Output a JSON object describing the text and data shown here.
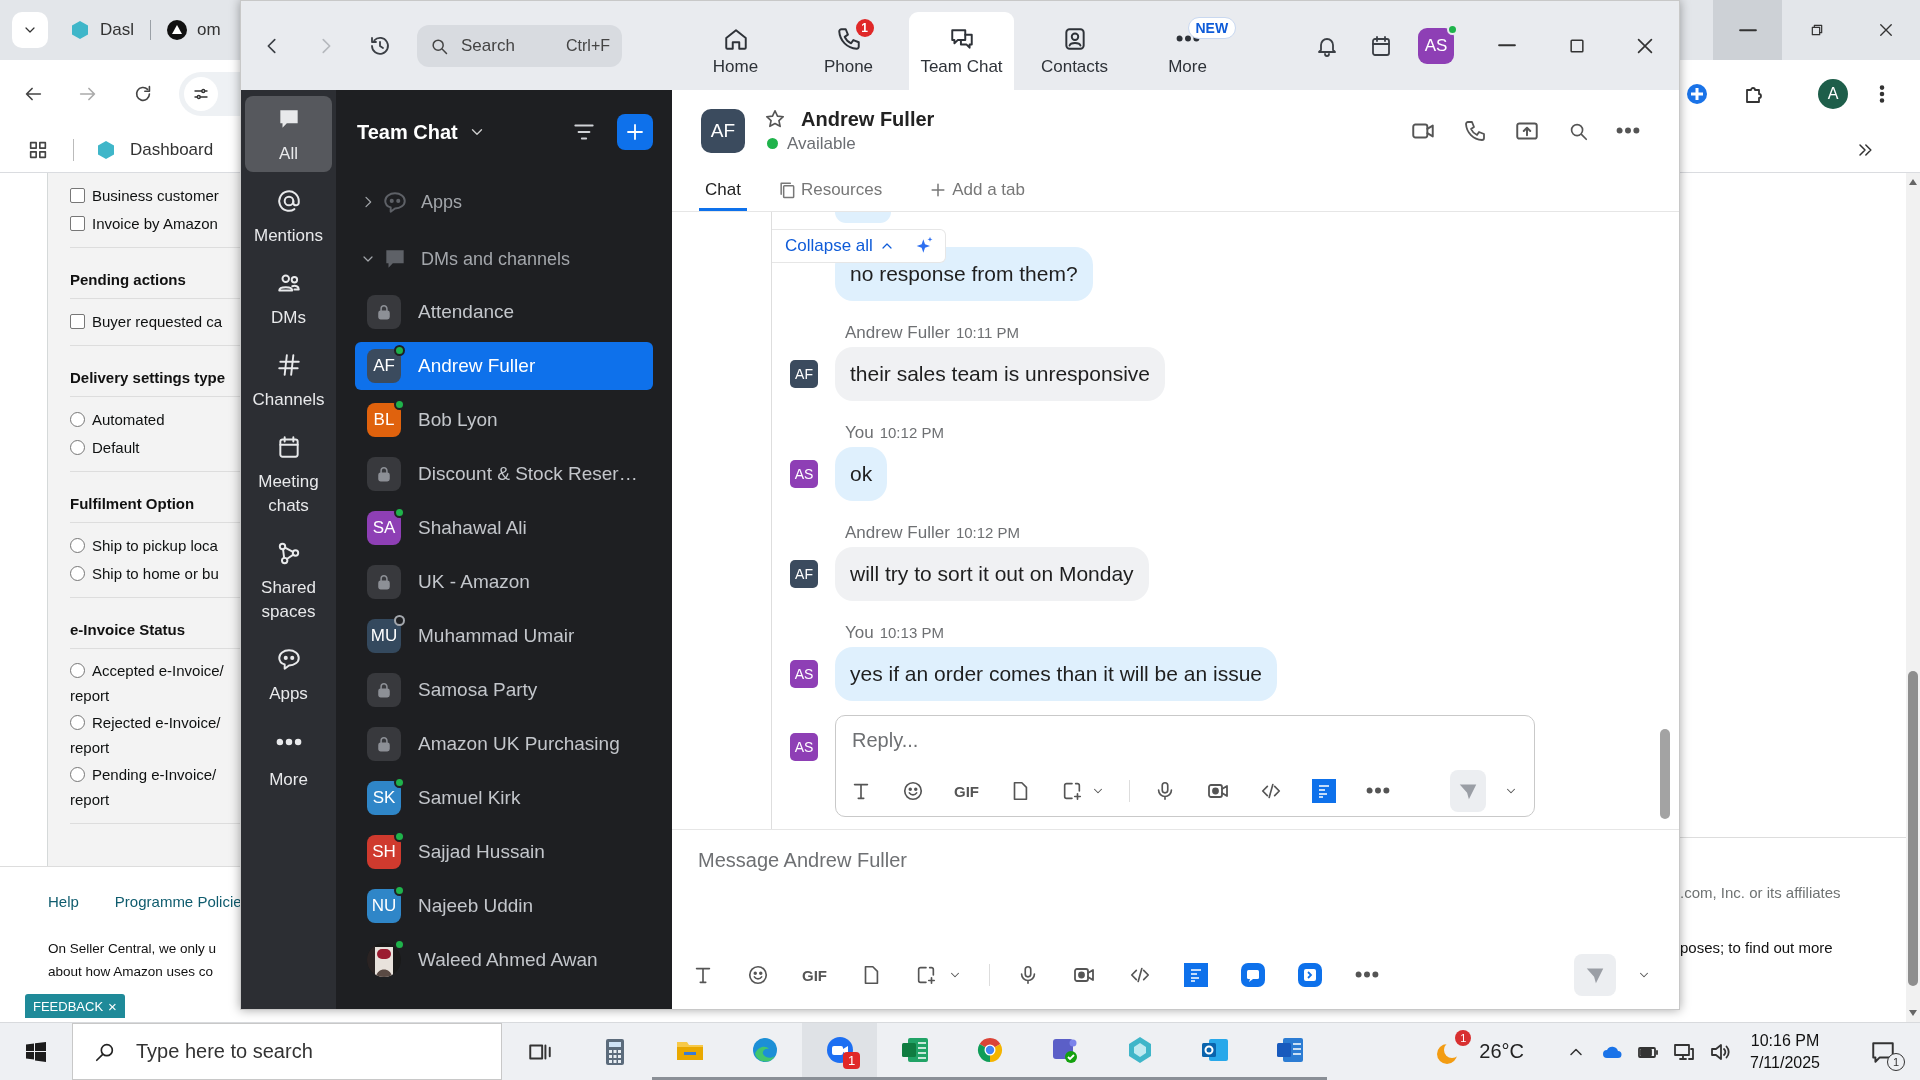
{
  "browser": {
    "tabs": [
      {
        "label": "Dasl"
      },
      {
        "label": "om"
      }
    ],
    "bookmarks": [
      {
        "label": "Dashboard"
      }
    ],
    "profile": {
      "initial": "A"
    },
    "filters": [
      {
        "options": [
          {
            "label": "Business customer",
            "kind": "checkbox",
            "checked": false
          },
          {
            "label": "Invoice by Amazon",
            "kind": "checkbox",
            "checked": false
          }
        ]
      },
      {
        "heading": "Pending actions",
        "options": [
          {
            "label": "Buyer requested ca",
            "kind": "checkbox",
            "checked": false
          }
        ]
      },
      {
        "heading": "Delivery settings type",
        "options": [
          {
            "label": "Automated",
            "kind": "radio",
            "checked": false
          },
          {
            "label": "Default",
            "kind": "radio",
            "checked": false
          }
        ]
      },
      {
        "heading": "Fulfilment Option",
        "options": [
          {
            "label": "Ship to pickup loca",
            "kind": "radio",
            "checked": false
          },
          {
            "label": "Ship to home or bu",
            "kind": "radio",
            "checked": false
          }
        ]
      },
      {
        "heading": "e-Invoice Status",
        "options": [
          {
            "label": "Accepted e-Invoice/",
            "continuation": "report",
            "kind": "radio",
            "checked": false
          },
          {
            "label": "Rejected e-Invoice/",
            "continuation": "report",
            "kind": "radio",
            "checked": false
          },
          {
            "label": "Pending e-Invoice/",
            "continuation": "report",
            "kind": "radio",
            "checked": false
          }
        ]
      }
    ],
    "footer_links": [
      {
        "label": "Help"
      },
      {
        "label": "Programme Policie"
      }
    ],
    "footer_lines": [
      "On Seller Central, we only u",
      "about how Amazon uses co"
    ],
    "copyright": ".com, Inc. or its affiliates",
    "footer_right": "poses; to find out more",
    "feedback": {
      "label": "FEEDBACK",
      "close": "×"
    }
  },
  "zoom": {
    "nav": {
      "forward_disabled": true
    },
    "search": {
      "placeholder": "Search",
      "shortcut": "Ctrl+F"
    },
    "tabs": [
      {
        "label": "Home",
        "selected": false
      },
      {
        "label": "Phone",
        "selected": false,
        "badge": {
          "text": "1",
          "kind": "count"
        }
      },
      {
        "label": "Team Chat",
        "selected": true
      },
      {
        "label": "Contacts",
        "selected": false
      },
      {
        "label": "More",
        "selected": false,
        "badge": {
          "text": "NEW",
          "kind": "label"
        }
      }
    ],
    "user": {
      "initials": "AS",
      "online": true
    },
    "rail": [
      {
        "label": "All",
        "selected": true
      },
      {
        "label": "Mentions",
        "selected": false
      },
      {
        "label": "DMs",
        "selected": false
      },
      {
        "label": "Channels",
        "selected": false
      },
      {
        "label": "Meeting chats",
        "selected": false
      },
      {
        "label": "Shared spaces",
        "selected": false
      },
      {
        "label": "Apps",
        "selected": false
      },
      {
        "label": "More",
        "selected": false
      }
    ],
    "list": {
      "title": "Team Chat",
      "sections": [
        {
          "label": "Apps",
          "expanded": false
        },
        {
          "label": "DMs and channels",
          "expanded": true,
          "items": [
            {
              "name": "Attendance",
              "kind": "channel",
              "selected": false
            },
            {
              "name": "Andrew Fuller",
              "kind": "person",
              "initials": "AF",
              "color": "#3b4b5e",
              "online": true,
              "selected": true
            },
            {
              "name": "Bob Lyon",
              "kind": "person",
              "initials": "BL",
              "color": "#e0620d",
              "online": true,
              "selected": false
            },
            {
              "name": "Discount & Stock Reser…",
              "kind": "channel",
              "selected": false
            },
            {
              "name": "Shahawal Ali",
              "kind": "person",
              "initials": "SA",
              "color": "#8e3fb5",
              "online": true,
              "selected": false
            },
            {
              "name": "UK - Amazon",
              "kind": "channel",
              "selected": false
            },
            {
              "name": "Muhammad Umair",
              "kind": "person",
              "initials": "MU",
              "color": "#34495e",
              "online": false,
              "selected": false
            },
            {
              "name": "Samosa Party",
              "kind": "channel",
              "selected": false
            },
            {
              "name": "Amazon UK Purchasing",
              "kind": "channel",
              "selected": false
            },
            {
              "name": "Samuel Kirk",
              "kind": "person",
              "initials": "SK",
              "color": "#2f86c8",
              "online": true,
              "selected": false
            },
            {
              "name": "Sajjad Hussain",
              "kind": "person",
              "initials": "SH",
              "color": "#cf3a2e",
              "online": true,
              "selected": false
            },
            {
              "name": "Najeeb Uddin",
              "kind": "person",
              "initials": "NU",
              "color": "#2f86c8",
              "online": true,
              "selected": false
            },
            {
              "name": "Waleed Ahmed Awan",
              "online": true,
              "selected": false
            }
          ]
        }
      ]
    },
    "chat": {
      "contact": {
        "initials": "AF",
        "name": "Andrew Fuller",
        "status": "Available",
        "online": true,
        "starred": false
      },
      "tabs": [
        {
          "label": "Chat",
          "selected": true
        },
        {
          "label": "Resources",
          "selected": false
        }
      ],
      "add_tab": "Add a tab",
      "collapse_label": "Collapse all",
      "messages": [
        {
          "text": "no response from them?",
          "own": true
        },
        {
          "sender": "Andrew Fuller",
          "time": "10:11 PM",
          "initials": "AF",
          "text": "their sales team is unresponsive",
          "own": false
        },
        {
          "sender": "You",
          "time": "10:12 PM",
          "initials": "AS",
          "text": "ok",
          "own": true
        },
        {
          "sender": "Andrew Fuller",
          "time": "10:12 PM",
          "initials": "AF",
          "text": "will try to sort it out on Monday",
          "own": false
        },
        {
          "sender": "You",
          "time": "10:13 PM",
          "initials": "AS",
          "text": "yes if an order comes than it will be an issue",
          "own": true
        }
      ],
      "reply": {
        "avatar": "AS",
        "placeholder": "Reply...",
        "gif": "GIF"
      },
      "composer": {
        "placeholder": "Message Andrew Fuller",
        "gif": "GIF"
      }
    }
  },
  "taskbar": {
    "search_placeholder": "Type here to search",
    "apps": [
      {
        "running": false,
        "active": false
      },
      {
        "running": true,
        "active": false
      },
      {
        "running": true,
        "active": false
      },
      {
        "running": true,
        "active": true,
        "badge": "1"
      },
      {
        "running": true,
        "active": false
      },
      {
        "running": true,
        "active": false
      },
      {
        "running": true,
        "active": false
      },
      {
        "running": true,
        "active": false
      },
      {
        "running": true,
        "active": false
      },
      {
        "running": true,
        "active": false
      }
    ],
    "weather": {
      "temperature": "26°C",
      "badge": "1"
    },
    "time": "10:16 PM",
    "date": "7/11/2025",
    "notifications": "1"
  }
}
